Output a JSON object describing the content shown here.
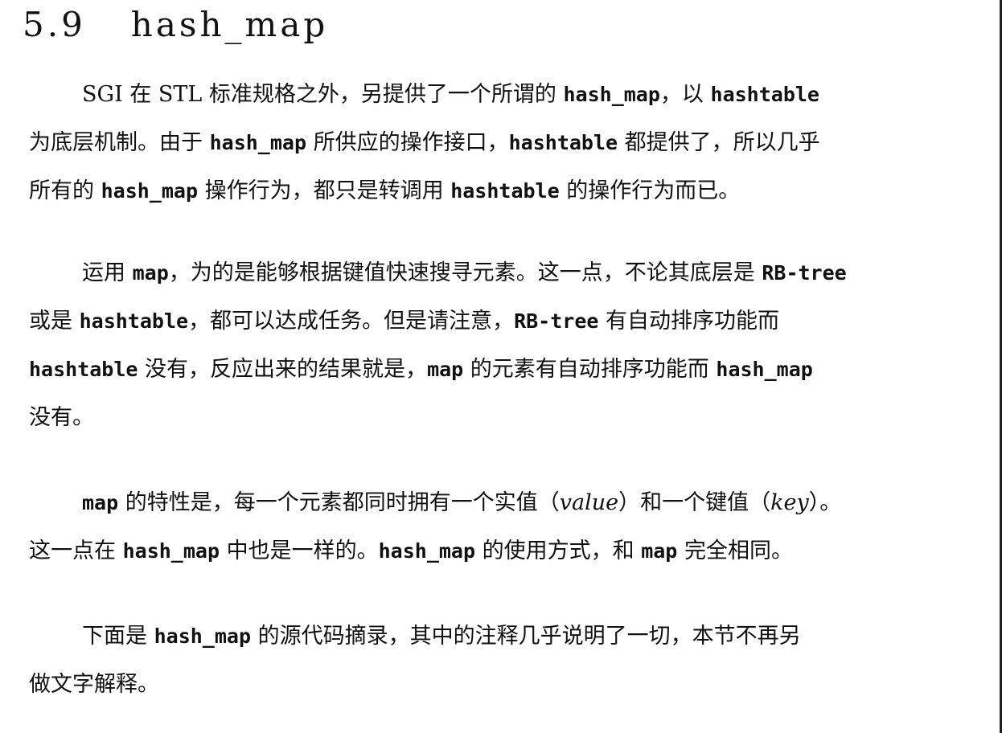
{
  "section": {
    "number": "5.9",
    "title": "hash_map"
  },
  "paragraphs": [
    {
      "lines": [
        {
          "segments": [
            {
              "t": "SGI 在 STL 标准规格之外，另提供了一个所谓的 "
            },
            {
              "t": "hash_map",
              "code": true
            },
            {
              "t": "，以 "
            },
            {
              "t": "hashtable",
              "code": true
            }
          ]
        },
        {
          "segments": [
            {
              "t": "为底层机制。由于 "
            },
            {
              "t": "hash_map",
              "code": true
            },
            {
              "t": " 所供应的操作接口，"
            },
            {
              "t": "hashtable",
              "code": true
            },
            {
              "t": " 都提供了，所以几乎"
            }
          ]
        },
        {
          "segments": [
            {
              "t": "所有的 "
            },
            {
              "t": "hash_map",
              "code": true
            },
            {
              "t": " 操作行为，都只是转调用 "
            },
            {
              "t": "hashtable",
              "code": true
            },
            {
              "t": " 的操作行为而已。"
            }
          ]
        }
      ]
    },
    {
      "lines": [
        {
          "segments": [
            {
              "t": "运用 "
            },
            {
              "t": "map",
              "code": true
            },
            {
              "t": "，为的是能够根据键值快速搜寻元素。这一点，不论其底层是 "
            },
            {
              "t": "RB-tree",
              "code": true
            }
          ]
        },
        {
          "segments": [
            {
              "t": "或是 "
            },
            {
              "t": "hashtable",
              "code": true
            },
            {
              "t": "，都可以达成任务。但是请注意，"
            },
            {
              "t": "RB-tree",
              "code": true
            },
            {
              "t": " 有自动排序功能而"
            }
          ]
        },
        {
          "segments": [
            {
              "t": "hashtable",
              "code": true
            },
            {
              "t": " 没有，反应出来的结果就是，"
            },
            {
              "t": "map",
              "code": true
            },
            {
              "t": " 的元素有自动排序功能而 "
            },
            {
              "t": "hash_map",
              "code": true
            }
          ]
        },
        {
          "segments": [
            {
              "t": "没有。"
            }
          ]
        }
      ]
    },
    {
      "lines": [
        {
          "segments": [
            {
              "t": "map",
              "code": true
            },
            {
              "t": " 的特性是，每一个元素都同时拥有一个实值（"
            },
            {
              "t": "value",
              "italic": true
            },
            {
              "t": "）和一个键值（"
            },
            {
              "t": "key",
              "italic": true
            },
            {
              "t": "）。"
            }
          ]
        },
        {
          "segments": [
            {
              "t": "这一点在 "
            },
            {
              "t": "hash_map",
              "code": true
            },
            {
              "t": " 中也是一样的。"
            },
            {
              "t": "hash_map",
              "code": true
            },
            {
              "t": " 的使用方式，和 "
            },
            {
              "t": "map",
              "code": true
            },
            {
              "t": " 完全相同。"
            }
          ]
        }
      ]
    },
    {
      "lines": [
        {
          "segments": [
            {
              "t": "下面是 "
            },
            {
              "t": "hash_map",
              "code": true
            },
            {
              "t": " 的源代码摘录，其中的注释几乎说明了一切，本节不再另"
            }
          ]
        },
        {
          "segments": [
            {
              "t": "做文字解释。"
            }
          ]
        }
      ]
    }
  ]
}
